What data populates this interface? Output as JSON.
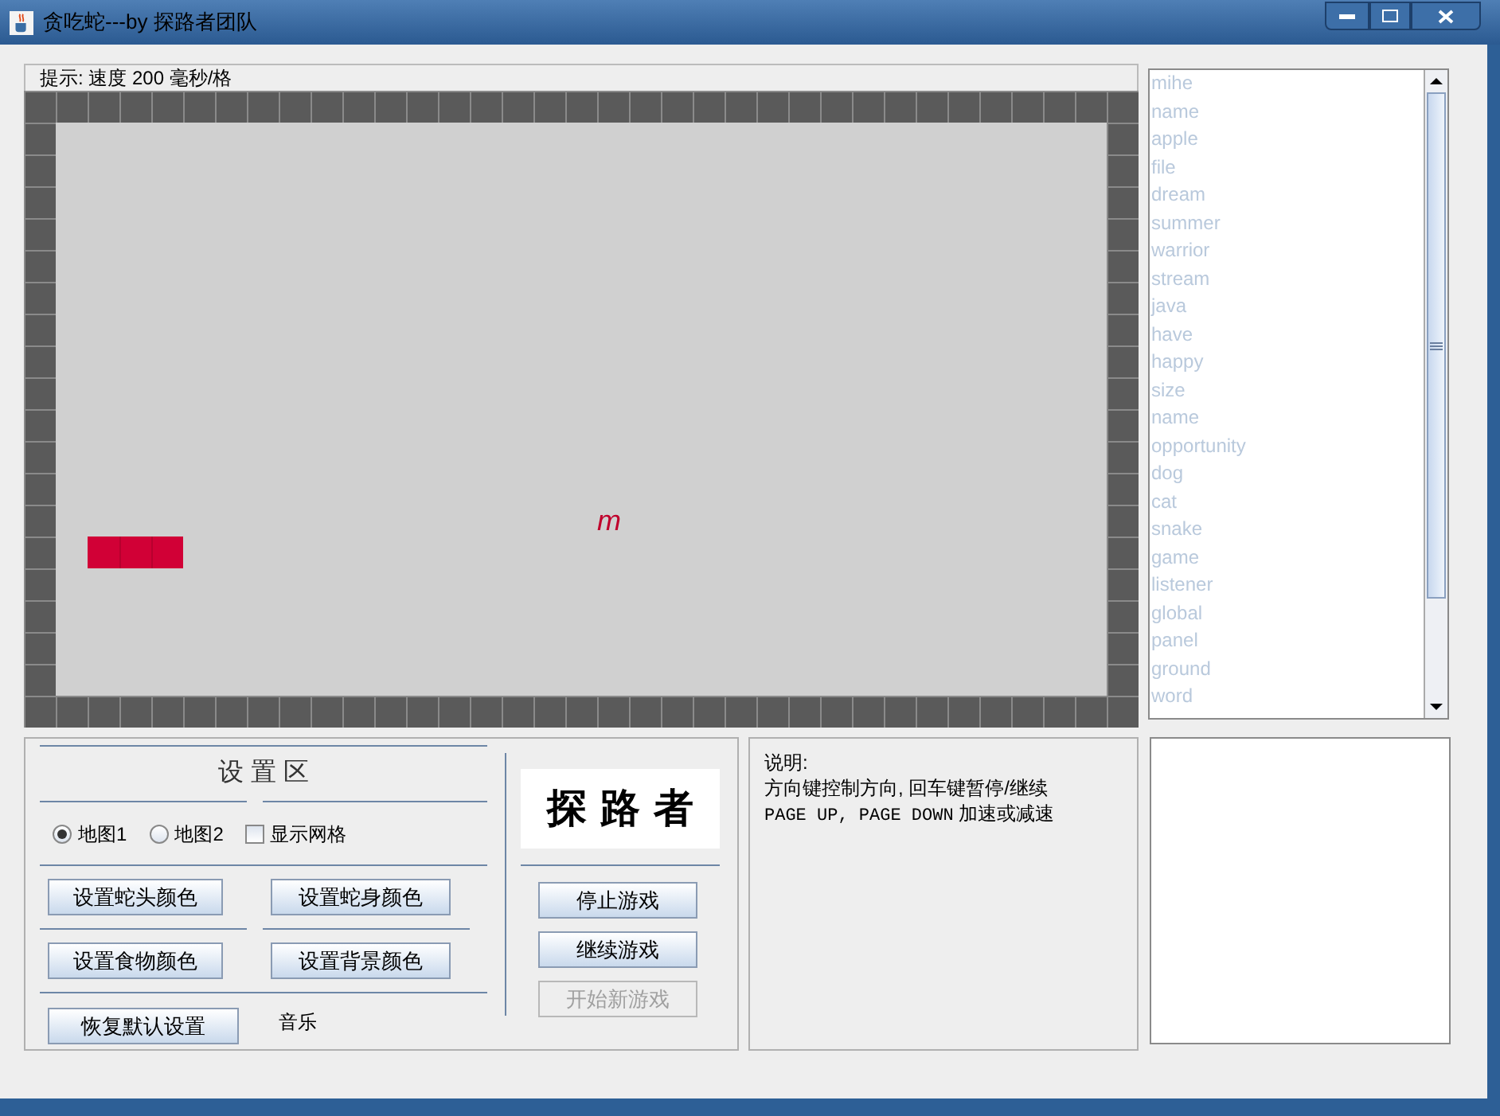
{
  "window": {
    "title": "贪吃蛇---by 探路者团队"
  },
  "game": {
    "hint": "提示: 速度 200 毫秒/格",
    "food_letter": "m"
  },
  "word_list": {
    "items": [
      "mihe",
      "name",
      "apple",
      "file",
      "dream",
      "summer",
      "warrior",
      "stream",
      "java",
      "have",
      "happy",
      "size",
      "name",
      "opportunity",
      "dog",
      "cat",
      "snake",
      "game",
      "listener",
      "global",
      "panel",
      "ground",
      "word"
    ]
  },
  "settings": {
    "title": "设 置 区",
    "maps": [
      {
        "label": "地图1",
        "selected": true
      },
      {
        "label": "地图2",
        "selected": false
      }
    ],
    "show_grid": {
      "label": "显示网格",
      "checked": false
    },
    "color_buttons": [
      "设置蛇头颜色",
      "设置蛇身颜色",
      "设置食物颜色",
      "设置背景颜色"
    ],
    "reset_button": "恢复默认设置",
    "music_label": "音乐"
  },
  "logo": {
    "text": "探 路 者"
  },
  "game_buttons": [
    {
      "label": "停止游戏",
      "disabled": false
    },
    {
      "label": "继续游戏",
      "disabled": false
    },
    {
      "label": "开始新游戏",
      "disabled": true
    }
  ],
  "instructions": {
    "heading": "说明:",
    "line": "方向键控制方向, 回车键暂停/继续",
    "keys": "PAGE UP, PAGE DOWN",
    "action": "加速或减速"
  }
}
